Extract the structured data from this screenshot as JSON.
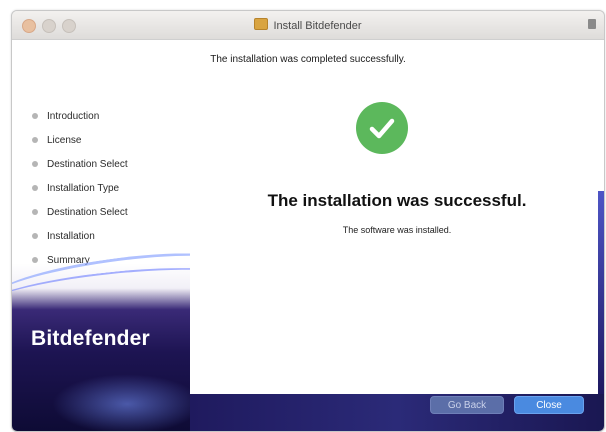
{
  "window": {
    "title": "Install Bitdefender"
  },
  "header": {
    "subtitle": "The installation was completed successfully."
  },
  "sidebar": {
    "steps": [
      {
        "label": "Introduction"
      },
      {
        "label": "License"
      },
      {
        "label": "Destination Select"
      },
      {
        "label": "Installation Type"
      },
      {
        "label": "Destination Select"
      },
      {
        "label": "Installation"
      },
      {
        "label": "Summary"
      }
    ],
    "brand": "Bitdefender"
  },
  "main": {
    "status_icon": "check-circle-icon",
    "title": "The installation was successful.",
    "message": "The software was installed."
  },
  "footer": {
    "back_label": "Go Back",
    "close_label": "Close"
  },
  "colors": {
    "success": "#5cb85c",
    "primary_button": "#4a8ae0",
    "brand_dark": "#1d1452"
  }
}
